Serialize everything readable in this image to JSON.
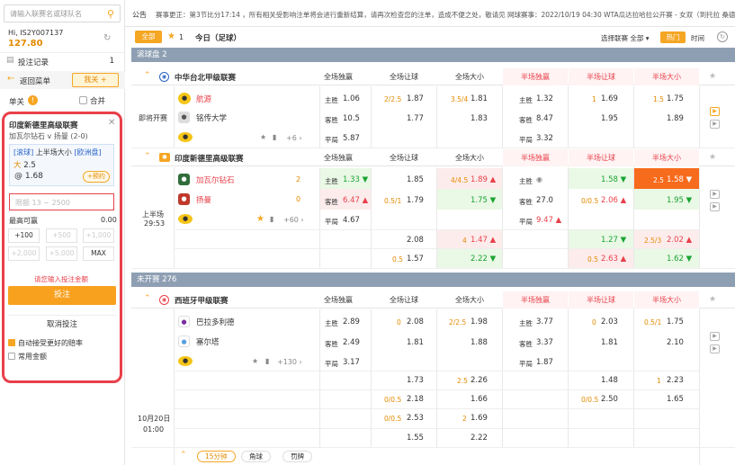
{
  "sidebar": {
    "search_placeholder": "请输入联赛名或球队名",
    "greeting": "Hi, IS2Y007137",
    "balance": "127.80",
    "bet_records": "投注记录",
    "bet_records_count": "1",
    "back_label": "返回菜单",
    "my_btn": "我关",
    "single_label": "单关",
    "merge_label": "合并"
  },
  "betslip": {
    "league": "印度新德里高级联赛",
    "match": "加瓦尔钻石 v 扬曼 (2-0)",
    "market_tag": "[滚球]",
    "market_name": "上半场大小",
    "market_type": "[欧洲盘]",
    "pick_side": "大",
    "pick_line": "2.5",
    "odds": "@ 1.68",
    "reserve_btn": "+预约",
    "stake_placeholder": "限额 13 ~ 2500",
    "max_win_label": "最高可赢",
    "max_win_value": "0.00",
    "quick": [
      "+100",
      "+500",
      "+1,000",
      "+2,000",
      "+5,000",
      "MAX"
    ],
    "warning": "请您输入投注金额",
    "place_btn": "投注",
    "cancel_btn": "取消投注",
    "auto_accept": "自动接受更好的赔率",
    "common_amount": "常用金额"
  },
  "topbar": {
    "notice_label": "公告",
    "notice_text": "赛事更正：第3节比分17:14 ，所有相关受影响注单将会进行重新结算，请再次检查您的注单，造成不便之处，敬请见谅!",
    "notice_right": "网球赛事：2022/10/19 04:30 WTA瓜达拉哈拉公开赛 - 女双（到托拉 桑德"
  },
  "filter": {
    "all": "全部",
    "fav_count": "1",
    "today": "今日（足球）",
    "select_league": "选择联赛 全部",
    "hot": "热门",
    "time": "时间"
  },
  "sections": {
    "live": "滚球盘 2",
    "upcoming": "未开赛 276"
  },
  "columns": [
    "全场独赢",
    "全场让球",
    "全场大小",
    "半场独赢",
    "半场让球",
    "半场大小"
  ],
  "match1": {
    "league": "中华台北甲级联赛",
    "status": "即将开赛",
    "home": "航源",
    "away": "铭传大学",
    "more": "+6",
    "lbl_home": "主胜",
    "lbl_away": "客胜",
    "lbl_draw": "平局",
    "ft1x2": [
      "1.06",
      "10.5",
      "5.87"
    ],
    "ft_hdp_line": "2/2.5",
    "ft_hdp": [
      "1.87",
      "1.77"
    ],
    "ft_ou_line": "3.5/4",
    "ft_ou": [
      "1.81",
      "1.83"
    ],
    "ht1x2": [
      "1.32",
      "8.47",
      "3.32"
    ],
    "ht_hdp_line": "1",
    "ht_hdp": [
      "1.69",
      "1.95"
    ],
    "ht_ou_line": "1.5",
    "ht_ou": [
      "1.75",
      "1.89"
    ]
  },
  "match2": {
    "league": "印度新德里高级联赛",
    "status": "上半场",
    "clock": "29:53",
    "home": "加瓦尔钻石",
    "away": "扬曼",
    "home_score": "2",
    "away_score": "0",
    "more": "+60",
    "ft1x2": [
      "1.33",
      "6.47",
      "4.67"
    ],
    "ft_hdp_line": "0.5/1",
    "ft_hdp": [
      "1.85",
      "1.79"
    ],
    "ft_ou_line": "4/4.5",
    "ft_ou": [
      "1.89",
      "1.75"
    ],
    "ht1x2": [
      "27.0",
      "9.47"
    ],
    "ht_hdp_line": "0/0.5",
    "ht_hdp": [
      "1.58",
      "2.06"
    ],
    "ht_ou_line": "2.5",
    "ht_ou": [
      "1.58",
      "1.95"
    ],
    "extra1_hdp": "2.08",
    "extra1_ou_line": "4",
    "extra1_ou": "1.47",
    "extra1_hthdp": "1.27",
    "extra1_htou_line": "2.5/3",
    "extra1_htou": "2.02",
    "extra2_hdp_line": "0.5",
    "extra2_hdp": "1.57",
    "extra2_ou": "2.22",
    "extra2_hthdp_line": "0.5",
    "extra2_hthdp": "2.63",
    "extra2_htou": "1.62"
  },
  "match3": {
    "league": "西班牙甲级联赛",
    "date": "10月20日",
    "time": "01:00",
    "home": "巴拉多利德",
    "away": "塞尔塔",
    "more": "+130",
    "ft1x2": [
      "2.89",
      "2.49",
      "3.17"
    ],
    "ft_hdp_line": "0",
    "ft_hdp": [
      "2.08",
      "1.81"
    ],
    "ft_ou_line": "2/2.5",
    "ft_ou": [
      "1.98",
      "1.88"
    ],
    "ht1x2": [
      "3.77",
      "3.37",
      "1.87"
    ],
    "ht_hdp_line": "0",
    "ht_hdp": [
      "2.03",
      "1.81"
    ],
    "ht_ou_line": "0.5/1",
    "ht_ou": [
      "1.75",
      "2.10"
    ],
    "r3_hdp": "1.73",
    "r3_ou_line": "2.5",
    "r3_ou": "2.26",
    "r3_hthdp": "1.48",
    "r3_htou_line": "1",
    "r3_htou": "2.23",
    "r4_hdp_line": "0/0.5",
    "r4_hdp": "2.18",
    "r4_ou": "1.66",
    "r4_hthdp_line": "0/0.5",
    "r4_hthdp": "2.50",
    "r4_htou": "1.65",
    "r5_hdp_line": "0/0.5",
    "r5_hdp": "2.53",
    "r5_ou_line": "2",
    "r5_ou": "1.69",
    "r6_hdp": "1.55",
    "r6_ou": "2.22",
    "tabs": [
      "15分钟",
      "角球",
      "罚牌"
    ]
  }
}
